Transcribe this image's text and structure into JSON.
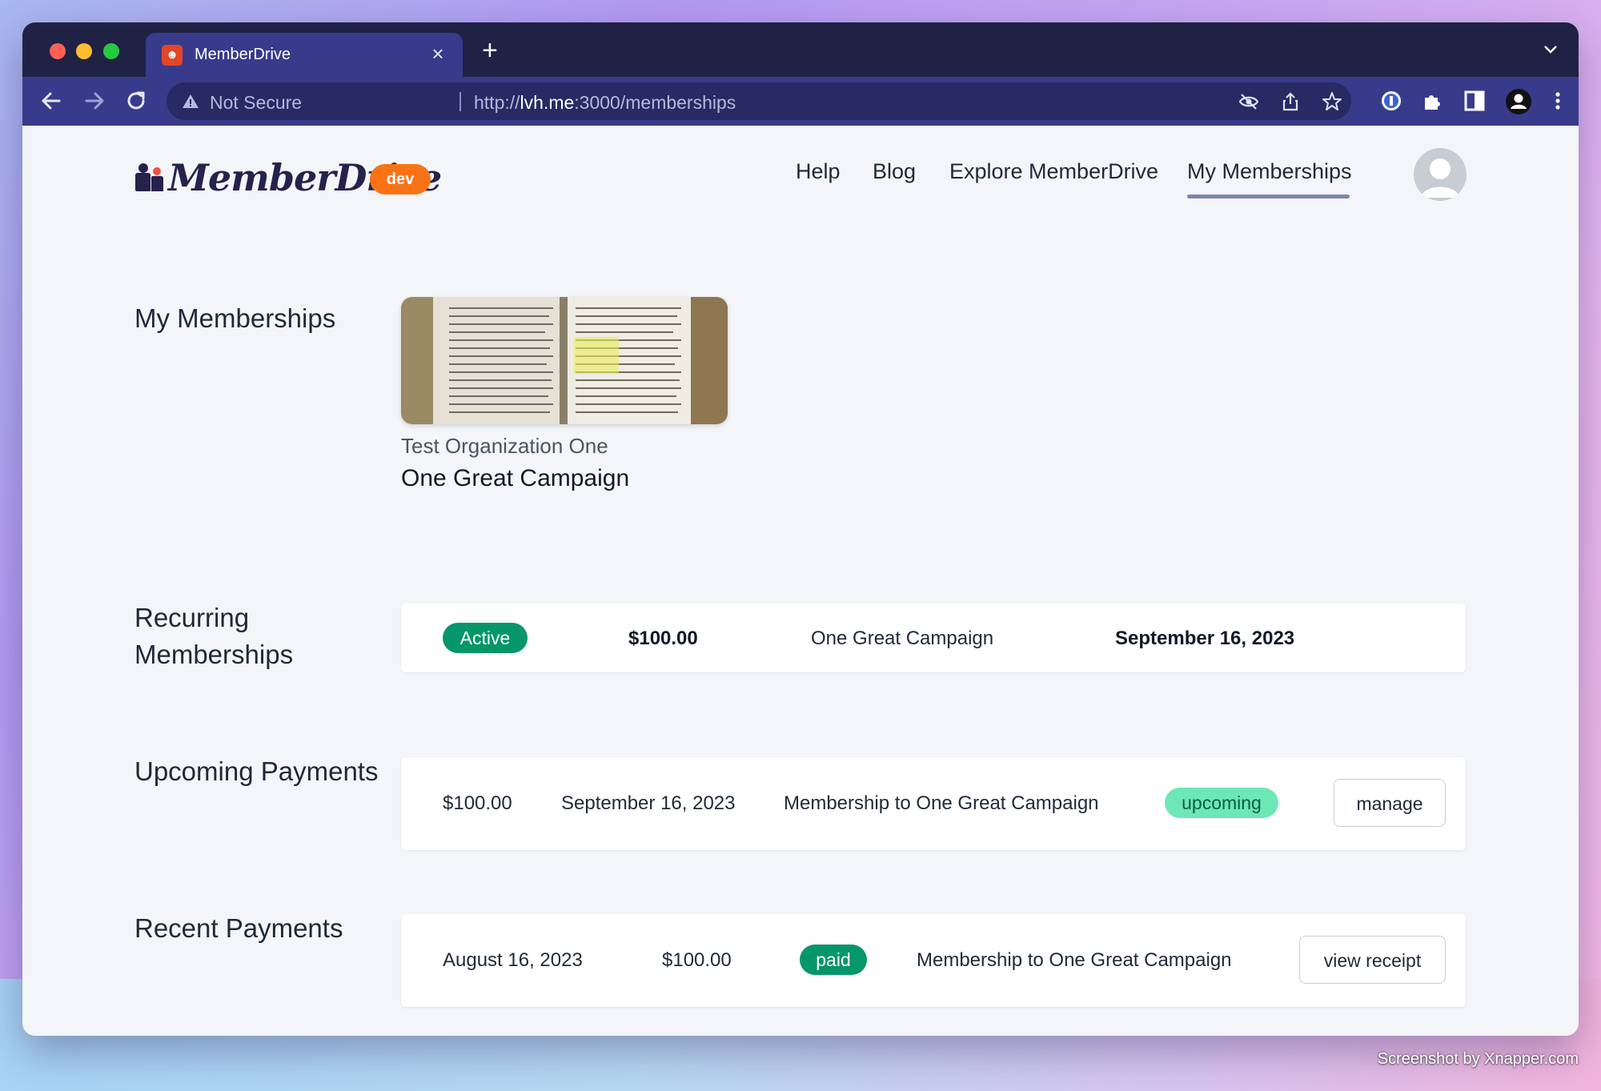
{
  "browser": {
    "tab_title": "MemberDrive",
    "tab_close": "×",
    "new_tab": "+",
    "security_label": "Not Secure",
    "url_scheme": "http://",
    "url_host": "lvh.me",
    "url_path": ":3000/memberships"
  },
  "header": {
    "logo_text": "MemberDrive",
    "env_badge": "dev",
    "nav": {
      "help": "Help",
      "blog": "Blog",
      "explore": "Explore MemberDrive",
      "my_memberships": "My Memberships"
    }
  },
  "sections": {
    "my_memberships": {
      "title": "My Memberships",
      "organization": "Test Organization One",
      "campaign": "One Great Campaign"
    },
    "recurring": {
      "title": "Recurring Memberships",
      "status": "Active",
      "amount": "$100.00",
      "campaign": "One Great Campaign",
      "date": "September 16, 2023"
    },
    "upcoming": {
      "title": "Upcoming Payments",
      "amount": "$100.00",
      "date": "September 16, 2023",
      "description": "Membership to One Great Campaign",
      "status": "upcoming",
      "action": "manage"
    },
    "recent": {
      "title": "Recent Payments",
      "date": "August 16, 2023",
      "amount": "$100.00",
      "status": "paid",
      "description": "Membership to One Great Campaign",
      "action": "view receipt"
    }
  },
  "watermark": "Screenshot by Xnapper.com",
  "colors": {
    "browser_frame": "#1f2244",
    "browser_toolbar": "#383b8b",
    "accent_orange": "#f97316",
    "status_green": "#059669",
    "status_light_green": "#6ee7b7"
  }
}
